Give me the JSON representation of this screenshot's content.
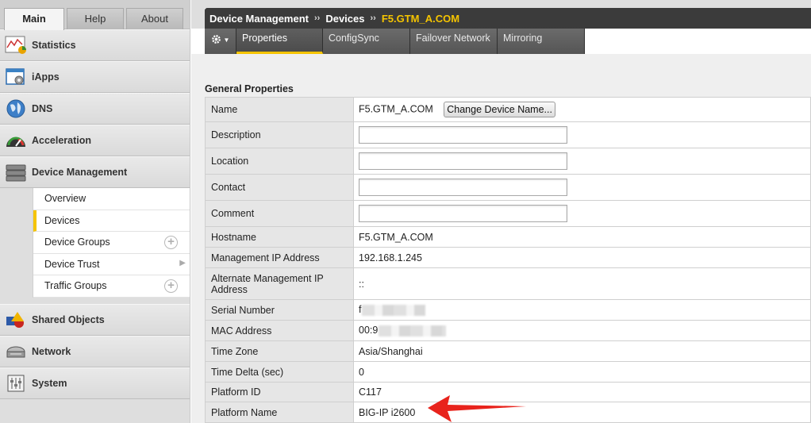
{
  "top_tabs": [
    {
      "label": "Main",
      "active": true
    },
    {
      "label": "Help",
      "active": false
    },
    {
      "label": "About",
      "active": false
    }
  ],
  "sidebar": {
    "items_top": [
      {
        "label": "Statistics",
        "icon": "statistics-icon"
      },
      {
        "label": "iApps",
        "icon": "iapps-icon"
      },
      {
        "label": "DNS",
        "icon": "dns-globe-icon"
      },
      {
        "label": "Acceleration",
        "icon": "acceleration-gauge-icon"
      },
      {
        "label": "Device Management",
        "icon": "device-management-icon"
      }
    ],
    "submenu": [
      {
        "label": "Overview",
        "active": false,
        "control": "none"
      },
      {
        "label": "Devices",
        "active": true,
        "control": "none"
      },
      {
        "label": "Device Groups",
        "active": false,
        "control": "plus"
      },
      {
        "label": "Device Trust",
        "active": false,
        "control": "arrow"
      },
      {
        "label": "Traffic Groups",
        "active": false,
        "control": "plus"
      }
    ],
    "items_bottom": [
      {
        "label": "Shared Objects",
        "icon": "shared-objects-icon"
      },
      {
        "label": "Network",
        "icon": "network-icon"
      },
      {
        "label": "System",
        "icon": "system-icon"
      }
    ]
  },
  "breadcrumb": {
    "part1": "Device Management",
    "sep": "››",
    "part2": "Devices",
    "current": "F5.GTM_A.COM"
  },
  "subtabs": [
    {
      "label": "Properties",
      "active": true
    },
    {
      "label": "ConfigSync",
      "active": false
    },
    {
      "label": "Failover Network",
      "active": false
    },
    {
      "label": "Mirroring",
      "active": false
    }
  ],
  "section_title": "General Properties",
  "properties": {
    "name": {
      "label": "Name",
      "value": "F5.GTM_A.COM",
      "button": "Change Device Name..."
    },
    "description": {
      "label": "Description",
      "value": ""
    },
    "location": {
      "label": "Location",
      "value": ""
    },
    "contact": {
      "label": "Contact",
      "value": ""
    },
    "comment": {
      "label": "Comment",
      "value": ""
    },
    "hostname": {
      "label": "Hostname",
      "value": "F5.GTM_A.COM"
    },
    "mgmt_ip": {
      "label": "Management IP Address",
      "value": "192.168.1.245"
    },
    "alt_mgmt_ip": {
      "label": "Alternate Management IP Address",
      "value": "::"
    },
    "serial": {
      "label": "Serial Number",
      "value": "f"
    },
    "mac": {
      "label": "MAC Address",
      "value": "00:9"
    },
    "timezone": {
      "label": "Time Zone",
      "value": "Asia/Shanghai"
    },
    "time_delta": {
      "label": "Time Delta (sec)",
      "value": "0"
    },
    "platform_id": {
      "label": "Platform ID",
      "value": "C117"
    },
    "platform_name": {
      "label": "Platform Name",
      "value": "BIG-IP i2600"
    }
  },
  "colors": {
    "accent": "#f5c400",
    "header_bg": "#3b3b3b",
    "annotation_arrow": "#e8231c"
  }
}
